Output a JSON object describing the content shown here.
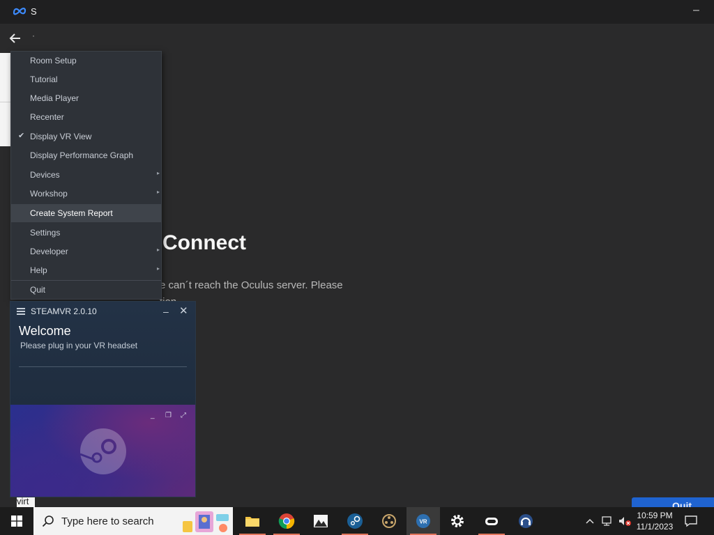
{
  "app": {
    "title": "S",
    "dot": "·"
  },
  "connect": {
    "title": "Connect",
    "body": "e can´t reach the Oculus server. Please  tion."
  },
  "menu": {
    "items": [
      {
        "label": "Room Setup",
        "checked": false,
        "submenu": false
      },
      {
        "label": "Tutorial",
        "checked": false,
        "submenu": false
      },
      {
        "label": "Media Player",
        "checked": false,
        "submenu": false
      },
      {
        "label": "Recenter",
        "checked": false,
        "submenu": false
      },
      {
        "label": "Display VR View",
        "checked": true,
        "submenu": false
      },
      {
        "label": "Display Performance Graph",
        "checked": false,
        "submenu": false
      },
      {
        "label": "Devices",
        "checked": false,
        "submenu": true
      },
      {
        "label": "Workshop",
        "checked": false,
        "submenu": true
      },
      {
        "label": "Create System Report",
        "checked": false,
        "submenu": false,
        "hover": true
      },
      {
        "label": "Settings",
        "checked": false,
        "submenu": false
      },
      {
        "label": "Developer",
        "checked": false,
        "submenu": true
      },
      {
        "label": "Help",
        "checked": false,
        "submenu": true
      },
      {
        "label": "Quit",
        "checked": false,
        "submenu": false
      }
    ],
    "check_glyph": "✔",
    "arrow_glyph": "▸"
  },
  "steamvr": {
    "title": "STEAMVR 2.0.10",
    "welcome": "Welcome",
    "subtitle": "Please plug in your VR headset",
    "minimize": "–",
    "close": "✕"
  },
  "partial": {
    "virt": "virt",
    "quit": "Quit"
  },
  "taskbar": {
    "search_placeholder": "Type here to search",
    "apps": [
      "file-explorer",
      "chrome",
      "photos",
      "steam",
      "cinema",
      "steamvr",
      "settings",
      "oculus",
      "remote"
    ],
    "clock_time": "10:59 PM",
    "clock_date": "11/1/2023"
  },
  "colors": {
    "accent": "#1f63d0",
    "menu_bg": "#2e3238",
    "steamvr_bg": "#1b2838"
  }
}
